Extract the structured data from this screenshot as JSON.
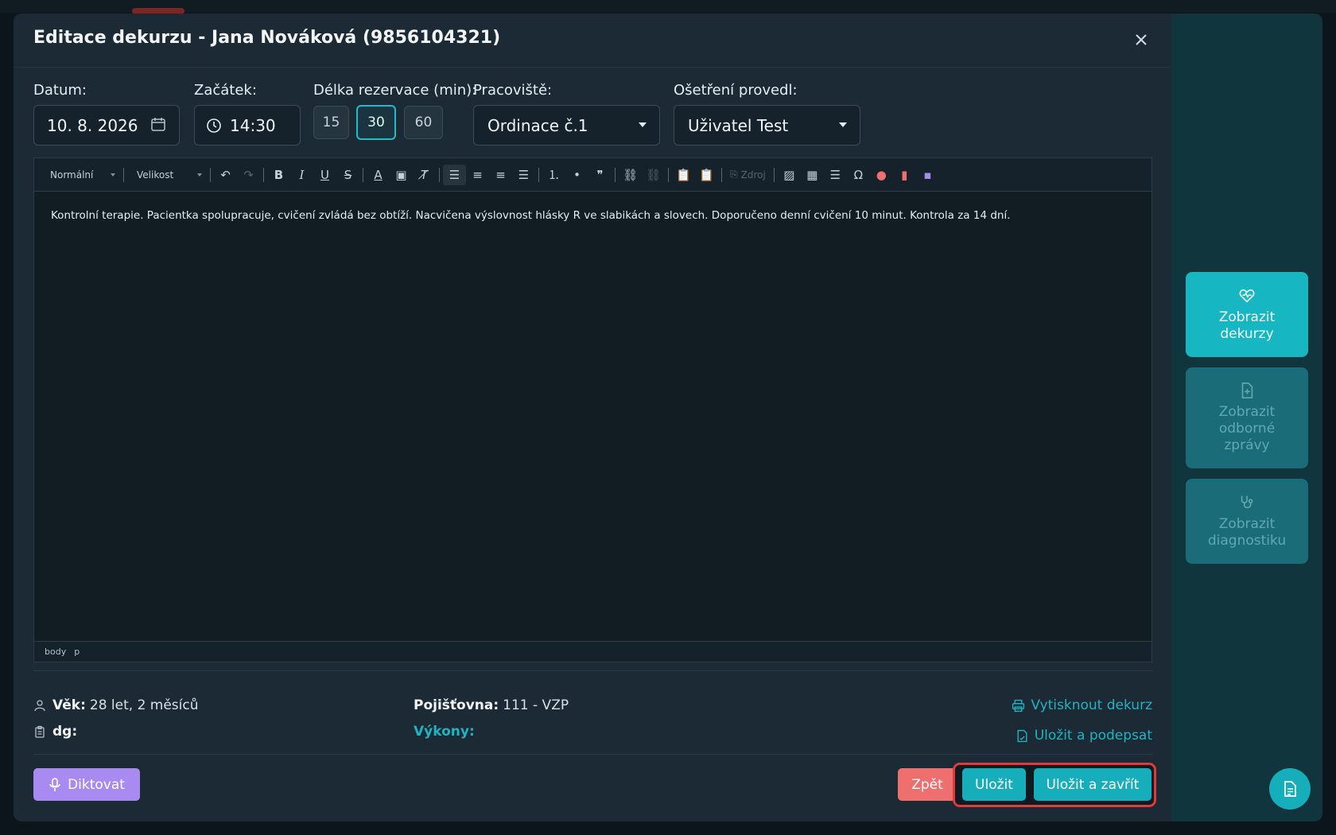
{
  "modal": {
    "title": "Editace dekurzu - Jana Nováková (9856104321)"
  },
  "form": {
    "date_label": "Datum:",
    "date_value": "10. 8. 2026",
    "start_label": "Začátek:",
    "start_value": "14:30",
    "duration_label": "Délka rezervace (min):",
    "durations": [
      "15",
      "30",
      "60"
    ],
    "duration_selected": "30",
    "workplace_label": "Pracoviště:",
    "workplace_value": "Ordinace č.1",
    "performer_label": "Ošetření provedl:",
    "performer_value": "Uživatel Test"
  },
  "editor": {
    "format_select": "Normální",
    "size_select": "Velikost",
    "source_label": "Zdroj",
    "content": "Kontrolní terapie. Pacientka spolupracuje, cvičení zvládá bez obtíží. Nacvičena výslovnost hlásky R ve slabikách a slovech. Doporučeno denní cvičení 10 minut. Kontrola za 14 dní.",
    "status_path": [
      "body",
      "p"
    ]
  },
  "patient": {
    "age_label": "Věk:",
    "age_value": "28 let, 2 měsíců",
    "dg_label": "dg:",
    "insurance_label": "Pojišťovna:",
    "insurance_value": "111 - VZP",
    "procedures_label": "Výkony:"
  },
  "actions": {
    "print": "Vytisknout dekurz",
    "save_sign": "Uložit a podepsat",
    "dictate": "Diktovat",
    "back": "Zpět",
    "save": "Uložit",
    "save_close": "Uložit a zavřít"
  },
  "sidebar": {
    "items": [
      {
        "label_1": "Zobrazit",
        "label_2": "dekurzy",
        "icon": "heart-pulse-icon"
      },
      {
        "label_1": "Zobrazit",
        "label_2": "odborné",
        "label_3": "zprávy",
        "icon": "file-plus-icon"
      },
      {
        "label_1": "Zobrazit",
        "label_2": "diagnostiku",
        "icon": "stethoscope-icon"
      }
    ]
  },
  "colors": {
    "accent": "#17aebb",
    "danger": "#ef6f6f",
    "dictate": "#a98af0",
    "highlight_border": "#e03a3a"
  }
}
